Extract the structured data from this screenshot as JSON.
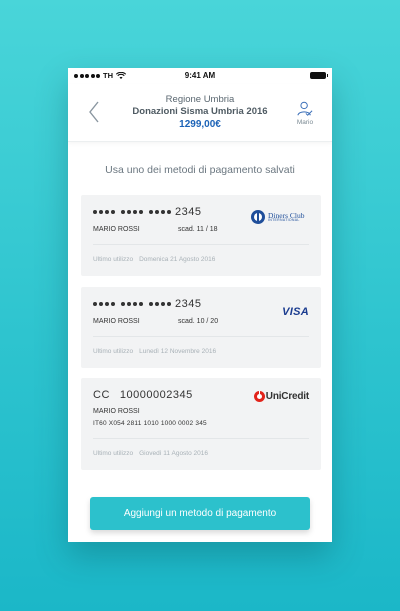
{
  "status_bar": {
    "carrier": "TH",
    "time": "9:41 AM"
  },
  "header": {
    "line1": "Regione Umbria",
    "line2": "Donazioni Sisma Umbria 2016",
    "amount": "1299,00€",
    "user_label": "Mario"
  },
  "subtitle": "Usa uno dei metodi di pagamento salvati",
  "cards": [
    {
      "brand": "Diners Club International",
      "brand_line1": "Diners Club",
      "brand_line2": "INTERNATIONAL",
      "last4": "2345",
      "holder": "MARIO ROSSI",
      "expiry": "scad.  11 / 18",
      "last_used_label": "Ultimo utilizzo",
      "last_used_date": "Domenica 21 Agosto 2016"
    },
    {
      "brand": "VISA",
      "last4": "2345",
      "holder": "MARIO ROSSI",
      "expiry": "scad.  10 / 20",
      "last_used_label": "Ultimo utilizzo",
      "last_used_date": "Lunedì 12 Novembre 2016"
    },
    {
      "brand": "UniCredit",
      "prefix": "CC",
      "number": "10000002345",
      "holder": "MARIO ROSSI",
      "iban": "IT60 X054 2811 1010 1000 0002 345",
      "last_used_label": "Ultimo utilizzo",
      "last_used_date": "Giovedì 11 Agosto 2016"
    }
  ],
  "add_button_label": "Aggiungi un metodo di pagamento",
  "colors": {
    "accent": "#2cc1cc",
    "amount": "#1c63b7",
    "card_bg": "#f2f3f4"
  }
}
